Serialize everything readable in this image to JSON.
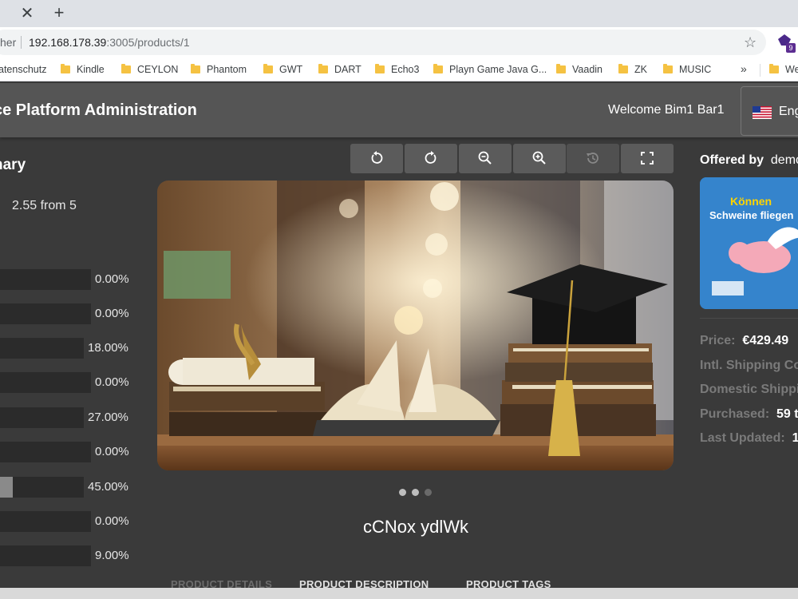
{
  "browser": {
    "address_prefix": "her",
    "url_host": "192.168.178.39",
    "url_path": ":3005/products/1",
    "extension_badge": "9",
    "bookmarks": [
      {
        "label": "atenschutz"
      },
      {
        "label": "Kindle"
      },
      {
        "label": "CEYLON"
      },
      {
        "label": "Phantom"
      },
      {
        "label": "GWT"
      },
      {
        "label": "DART"
      },
      {
        "label": "Echo3"
      },
      {
        "label": "Playn Game Java G..."
      },
      {
        "label": "Vaadin"
      },
      {
        "label": "ZK"
      },
      {
        "label": "MUSIC"
      },
      {
        "label": "We"
      }
    ],
    "bookmarks_more": "»"
  },
  "header": {
    "title": "ce Platform Administration",
    "welcome": "Welcome Bim1 Bar1",
    "language": "Eng"
  },
  "summary": {
    "title": "nary",
    "average": "2.55 from 5",
    "bars": [
      {
        "percent_label": "0.00%",
        "fill": 0.0
      },
      {
        "percent_label": "0.00%",
        "fill": 0.0
      },
      {
        "percent_label": "18.00%",
        "fill": 0.0
      },
      {
        "percent_label": "0.00%",
        "fill": 0.0
      },
      {
        "percent_label": "27.00%",
        "fill": 0.0
      },
      {
        "percent_label": "0.00%",
        "fill": 0.0
      },
      {
        "percent_label": "45.00%",
        "fill": 0.45
      },
      {
        "percent_label": "0.00%",
        "fill": 0.0
      },
      {
        "percent_label": "9.00%",
        "fill": 0.0
      }
    ]
  },
  "gallery": {
    "tools": [
      {
        "name": "rotate-left",
        "enabled": true
      },
      {
        "name": "rotate-right",
        "enabled": true
      },
      {
        "name": "zoom-out",
        "enabled": true
      },
      {
        "name": "zoom-in",
        "enabled": true
      },
      {
        "name": "reset-history",
        "enabled": false
      },
      {
        "name": "fullscreen",
        "enabled": true
      }
    ],
    "active_dot": 1,
    "dot_count": 3
  },
  "product": {
    "name": "cCNox ydlWk",
    "tabs": [
      "PRODUCT DETAILS",
      "PRODUCT DESCRIPTION",
      "PRODUCT TAGS"
    ]
  },
  "seller": {
    "offered_label": "Offered by",
    "offered_name": "demo",
    "thumb_text_1": "Können",
    "thumb_text_2": "Schweine fliegen"
  },
  "meta": {
    "price_key": "Price:",
    "price_val": "€429.49",
    "intl_shipping_key": "Intl. Shipping Co",
    "domestic_shipping_key": "Domestic Shippi",
    "purchased_key": "Purchased:",
    "purchased_val": "59 ti",
    "updated_key": "Last Updated:",
    "updated_val": "1"
  },
  "colors": {
    "header_bg": "#555555",
    "page_bg": "#3a3a3a",
    "bar_track": "#2b2b2b",
    "bar_fill": "#8a8a8a"
  }
}
